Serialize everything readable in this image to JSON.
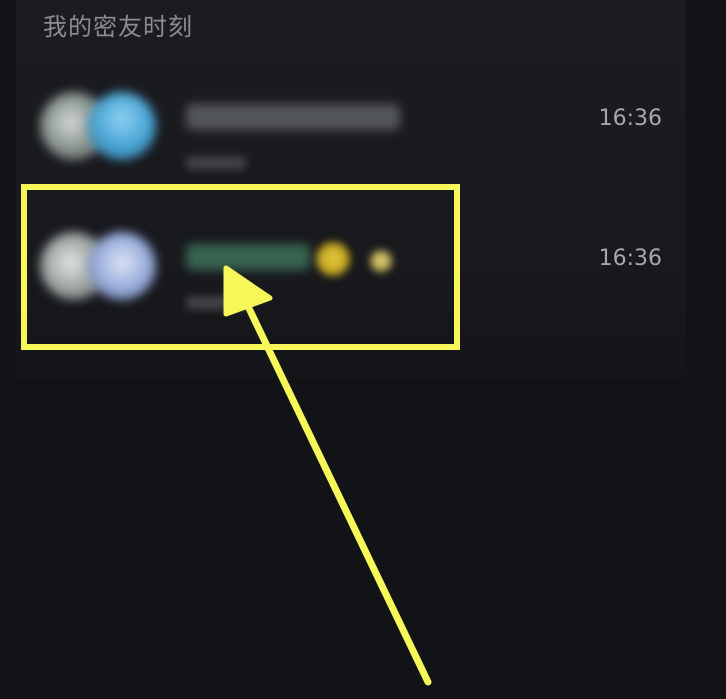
{
  "section": {
    "title": "我的密友时刻"
  },
  "rows": [
    {
      "time": "16:36"
    },
    {
      "time": "16:36"
    }
  ],
  "annotation": {
    "color": "#f7f75a"
  },
  "colors": {
    "background": "#121317",
    "card": "#1b1c20",
    "title_text": "#8b8d92",
    "time_text": "#a5a7ab"
  }
}
